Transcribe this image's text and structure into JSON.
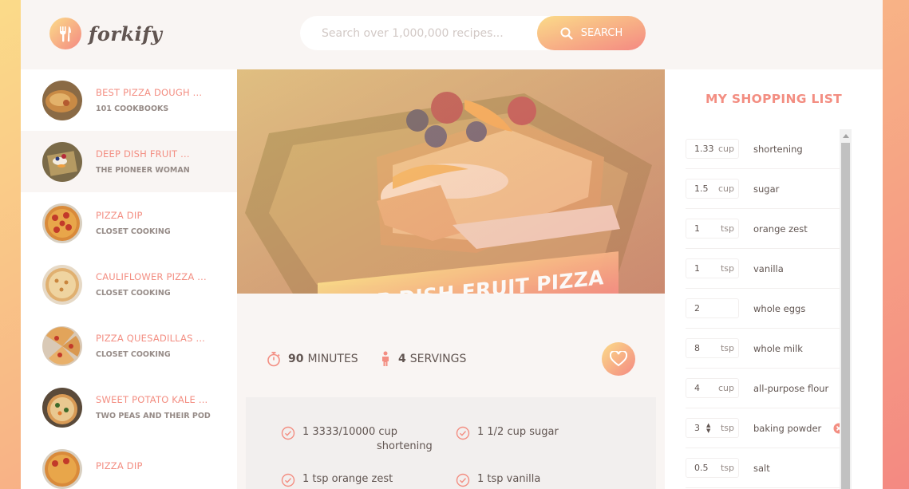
{
  "header": {
    "logo_text": "forkify",
    "search_placeholder": "Search over 1,000,000 recipes...",
    "search_button": "Search"
  },
  "results": [
    {
      "title": "Best Pizza Dough ...",
      "author": "101 Cookbooks",
      "active": false
    },
    {
      "title": "Deep Dish Fruit ...",
      "author": "The Pioneer Woman",
      "active": true
    },
    {
      "title": "Pizza Dip",
      "author": "Closet Cooking",
      "active": false
    },
    {
      "title": "Cauliflower Pizza ...",
      "author": "Closet Cooking",
      "active": false
    },
    {
      "title": "Pizza Quesadillas ...",
      "author": "Closet Cooking",
      "active": false
    },
    {
      "title": "Sweet Potato Kale ...",
      "author": "Two Peas and Their Pod",
      "active": false
    },
    {
      "title": "Pizza Dip",
      "author": "",
      "active": false
    }
  ],
  "recipe": {
    "title": "Deep Dish Fruit Pizza",
    "minutes": "90",
    "minutes_label": "minutes",
    "servings": "4",
    "servings_label": "servings",
    "ingredients": [
      {
        "text": "1 3333/10000 cup",
        "text2": "shortening"
      },
      {
        "text": "1 1/2 cup sugar",
        "text2": ""
      },
      {
        "text": "1 tsp orange zest",
        "text2": ""
      },
      {
        "text": "1 tsp vanilla",
        "text2": ""
      }
    ]
  },
  "shopping": {
    "title": "My Shopping List",
    "items": [
      {
        "count": "1.33",
        "unit": "cup",
        "desc": "shortening"
      },
      {
        "count": "1.5",
        "unit": "cup",
        "desc": "sugar"
      },
      {
        "count": "1",
        "unit": "tsp",
        "desc": "orange zest"
      },
      {
        "count": "1",
        "unit": "tsp",
        "desc": "vanilla"
      },
      {
        "count": "2",
        "unit": "",
        "desc": "whole eggs"
      },
      {
        "count": "8",
        "unit": "tsp",
        "desc": "whole milk"
      },
      {
        "count": "4",
        "unit": "cup",
        "desc": "all-purpose flour"
      },
      {
        "count": "3",
        "unit": "tsp",
        "desc": "baking powder"
      },
      {
        "count": "0.5",
        "unit": "tsp",
        "desc": "salt"
      }
    ]
  },
  "colors": {
    "accent": "#F38E82",
    "gradient_start": "#FBDB89",
    "gradient_end": "#F48982",
    "text": "#615551",
    "muted": "#968B87",
    "bg_light": "#F9F5F3"
  },
  "icons": {
    "logo": "fork-knife-icon",
    "search": "search-icon",
    "time": "stopwatch-icon",
    "servings": "person-icon",
    "love": "heart-icon",
    "ingredient": "check-icon",
    "delete": "close-circle-icon"
  }
}
